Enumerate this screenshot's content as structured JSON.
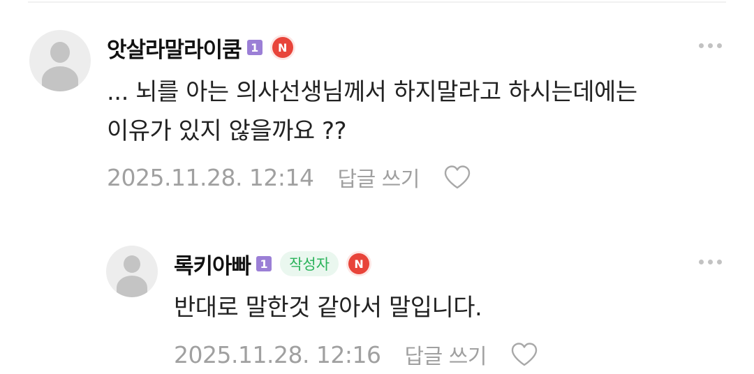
{
  "comments": [
    {
      "username": "앗살라말라이쿰",
      "level": "1",
      "n_badge": "N",
      "text": "... 뇌를 아는 의사선생님께서 하지말라고 하시는데에는\n이유가 있지 않을까요 ??",
      "date": "2025.11.28. 12:14",
      "reply_label": "답글 쓰기"
    },
    {
      "username": "록키아빠",
      "level": "1",
      "author_tag": "작성자",
      "n_badge": "N",
      "text": "반대로 말한것 같아서 말입니다.",
      "date": "2025.11.28. 12:16",
      "reply_label": "답글 쓰기"
    }
  ],
  "colors": {
    "accent_green": "#2bb35b",
    "level_purple": "#9b7fd6",
    "new_red": "#e8443a",
    "meta_gray": "#a0a0a0"
  },
  "icons": [
    "user-avatar-icon",
    "more-dots-icon",
    "heart-icon"
  ]
}
